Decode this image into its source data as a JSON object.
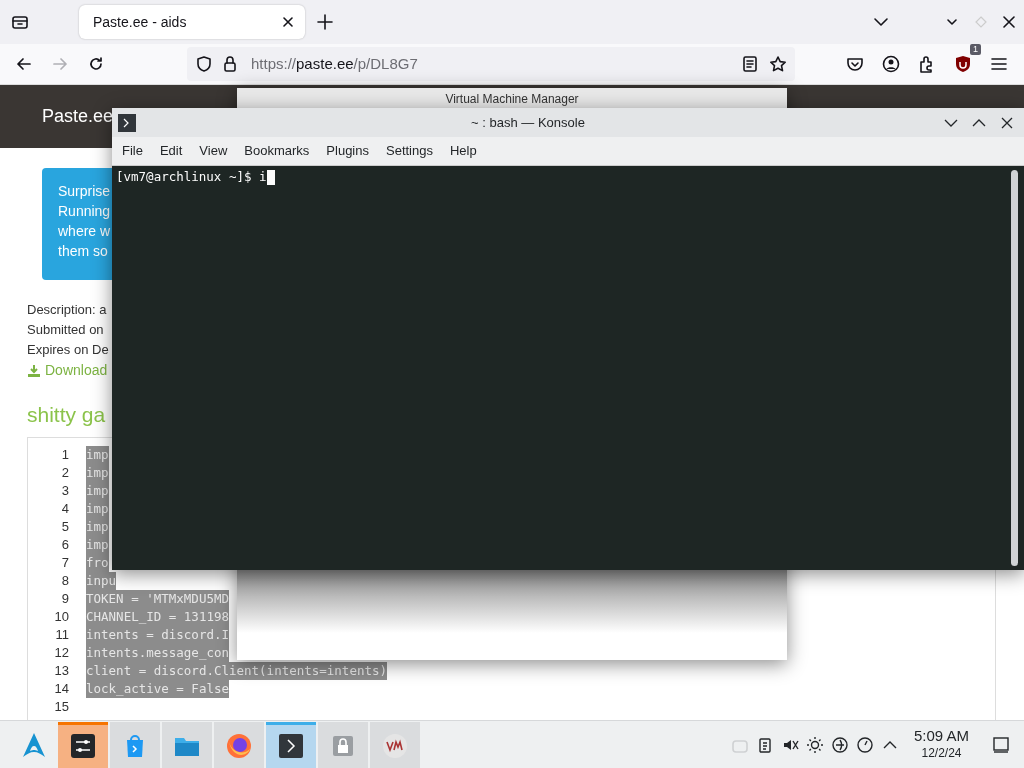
{
  "browser": {
    "tabs": [
      {
        "title": "Paste.ee - aids",
        "selected": true
      }
    ],
    "nav_buttons": [
      {
        "kind": "back",
        "disabled": false
      },
      {
        "kind": "forward",
        "disabled": true
      },
      {
        "kind": "reload",
        "disabled": false
      }
    ],
    "url": [
      {
        "text": "https://",
        "emphasis": false
      },
      {
        "text": "paste.ee",
        "emphasis": true
      },
      {
        "text": "/p/DL8G7",
        "emphasis": false
      }
    ],
    "extension_badge": "1"
  },
  "page": {
    "brand": "Paste.ee",
    "alert_lines": [
      "Surprise",
      "Running",
      "where w",
      "them so"
    ],
    "meta_lines": [
      "Description: a",
      "Submitted on",
      "Expires on De"
    ],
    "download": "Download",
    "heading": "shitty ga",
    "code_lines": [
      {
        "number": "1",
        "text": "imp",
        "selected": true
      },
      {
        "number": "2",
        "text": "imp",
        "selected": true
      },
      {
        "number": "3",
        "text": "imp",
        "selected": true
      },
      {
        "number": "4",
        "text": "imp",
        "selected": true
      },
      {
        "number": "5",
        "text": "imp",
        "selected": true
      },
      {
        "number": "6",
        "text": "imp",
        "selected": true
      },
      {
        "number": "7",
        "text": "fro",
        "selected": true
      },
      {
        "number": "8",
        "text": "inpu",
        "selected": true
      },
      {
        "number": "9",
        "text": "TOKEN = 'MTMxMDU5MD",
        "selected": true
      },
      {
        "number": "10",
        "text": "CHANNEL_ID = 131198",
        "selected": true
      },
      {
        "number": "11",
        "text": "intents = discord.I",
        "selected": true
      },
      {
        "number": "12",
        "text": "intents.message_con",
        "selected": true
      },
      {
        "number": "13",
        "text": "client = discord.Client(intents=intents)",
        "selected": true
      },
      {
        "number": "14",
        "text": "lock_active = False",
        "selected": true
      },
      {
        "number": "15",
        "selected": false
      }
    ]
  },
  "vmm_window": {
    "title": "Virtual Machine Manager"
  },
  "konsole": {
    "title": "~ : bash — Konsole",
    "menu": [
      "File",
      "Edit",
      "View",
      "Bookmarks",
      "Plugins",
      "Settings",
      "Help"
    ],
    "prompt": "[vm7@archlinux ~]$ ",
    "input": "i"
  },
  "taskbar": {
    "items": [
      {
        "kind": "settings",
        "selected": false,
        "attention": true
      },
      {
        "kind": "store",
        "selected": false,
        "attention": false
      },
      {
        "kind": "files",
        "selected": false,
        "attention": false
      },
      {
        "kind": "firefox",
        "selected": false,
        "attention": false
      },
      {
        "kind": "terminal",
        "selected": true,
        "attention": false
      },
      {
        "kind": "lock",
        "selected": false,
        "attention": false
      },
      {
        "kind": "vm",
        "selected": false,
        "attention": false
      }
    ],
    "clock": "5:09 AM",
    "date": "12/2/24"
  }
}
